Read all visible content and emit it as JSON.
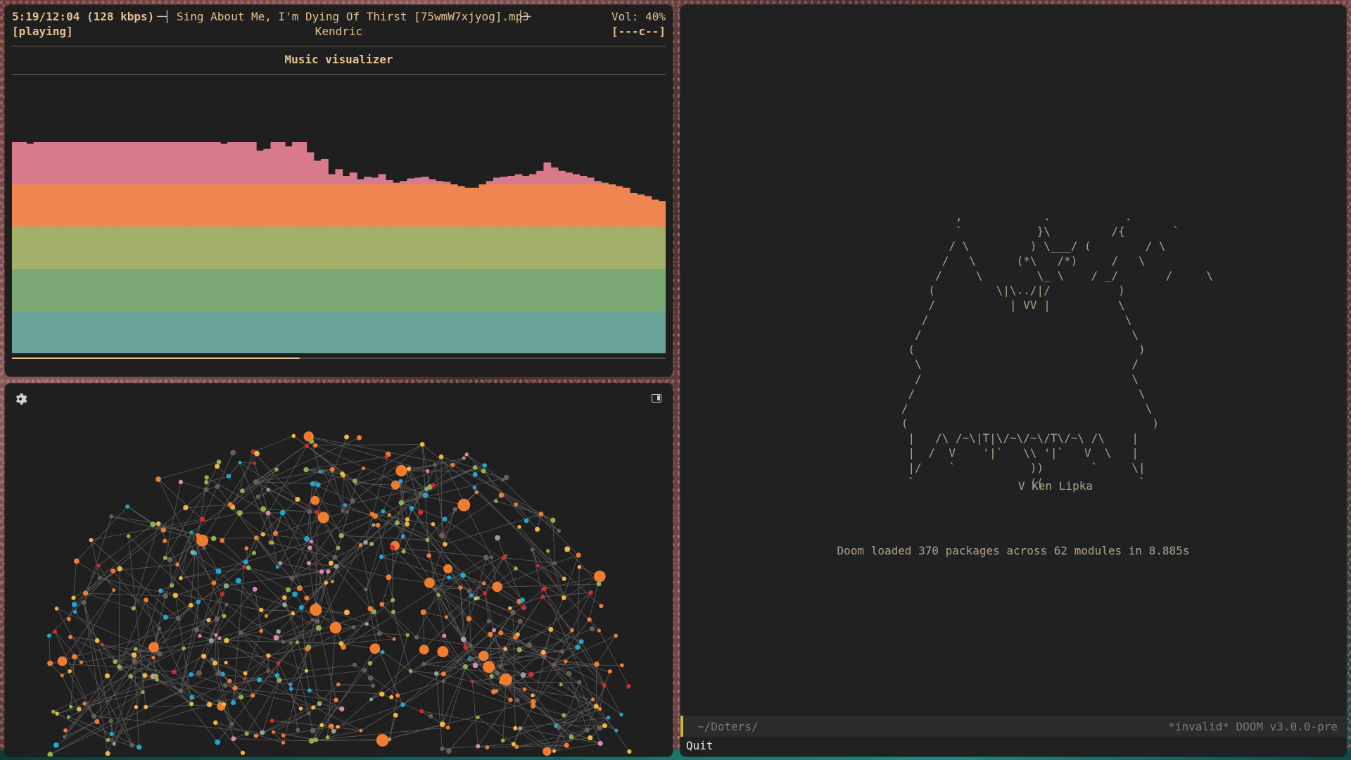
{
  "music": {
    "time": "5:19/12:04 (128 kbps)",
    "title_sep_left": "─┤",
    "track": "Sing About Me, I'm Dying Of Thirst [75wmW7xjyog].mp3",
    "title_sep_right": "├─",
    "volume": "Vol: 40%",
    "state": "[playing]",
    "artist": "Kendric",
    "flags": "[---c--]",
    "visualizer_title": "Music visualizer",
    "progress": 0.44,
    "band_colors": [
      "#69a39a",
      "#7ba874",
      "#a3b069",
      "#ef8550",
      "#d97a8c"
    ],
    "spectrum": [
      62,
      58,
      48,
      52,
      50,
      70,
      80,
      88,
      92,
      100,
      92,
      92,
      95,
      95,
      96,
      98,
      98,
      98,
      96,
      90,
      90,
      85,
      80,
      76,
      72,
      70,
      66,
      62,
      58,
      48,
      60,
      72,
      58,
      60,
      40,
      42,
      60,
      70,
      45,
      65,
      50,
      38,
      28,
      30,
      12,
      18,
      10,
      14,
      6,
      9,
      8,
      12,
      5,
      2,
      4,
      7,
      8,
      9,
      6,
      4,
      3,
      0,
      -2,
      -4,
      -4,
      0,
      4,
      8,
      9,
      10,
      12,
      10,
      12,
      16,
      26,
      20,
      16,
      14,
      12,
      10,
      8,
      4,
      2,
      0,
      -2,
      -4,
      -10,
      -12,
      -14,
      -18,
      -20
    ]
  },
  "graph": {
    "settings_icon": "gear-icon",
    "sidebar_icon": "sidebar-toggle-icon",
    "node_colors": [
      "#f07c30",
      "#1fa7d4",
      "#8fb04d",
      "#f2b640",
      "#d12d2d",
      "#6a5f58",
      "#8fa39a",
      "#d889b3"
    ]
  },
  "doom": {
    "ascii_art": "           ,            .           .\n           `           }\\         /{       `\n          / \\         ) \\___/ (        / \\\n         /   \\      (*\\   /*)     /   \\\n        /     \\        \\_ \\    / _/       /     \\\n       (         \\|\\../|/          )\n       /           | VV |          \\\n      /                             \\\n     /                               \\\n    (                                 )\n     \\                               /\n     /                               \\\n    /                                 \\\n   /                                   \\\n   (                                    )\n    |   /\\ /~\\|T|\\/~\\/~\\/T\\/~\\ /\\    |\n    |  /  V    '|`   \\\\ '|`   V  \\   |\n    |/    `           ))       `     \\|\n    `                 ((              `",
    "ascii_credit": "V Ken Lipka",
    "loaded_msg": "Doom loaded 370 packages across 62 modules in 8.885s",
    "modeline_path": "~/Doters/",
    "modeline_status": "*invalid* DOOM v3.0.0-pre",
    "minibuffer": "Quit"
  }
}
